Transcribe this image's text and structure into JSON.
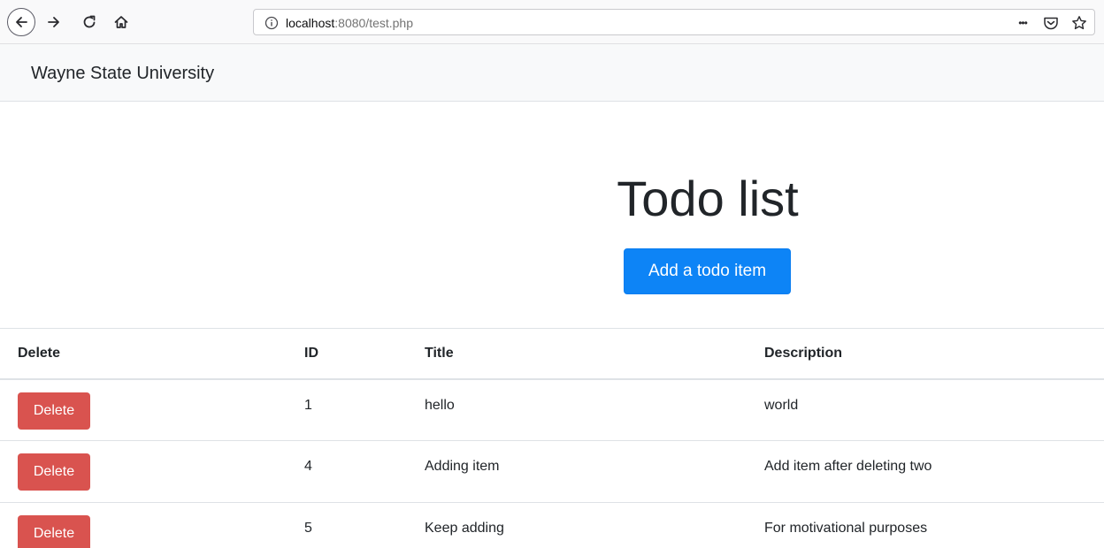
{
  "browser": {
    "url_host": "localhost",
    "url_rest": ":8080/test.php",
    "icons": [
      "back-arrow-icon",
      "forward-arrow-icon",
      "reload-icon",
      "home-icon",
      "info-icon",
      "more-icon",
      "pocket-icon",
      "bookmark-star-icon"
    ],
    "more_label": "•••"
  },
  "navbar": {
    "brand": "Wayne State University"
  },
  "main": {
    "title": "Todo list",
    "add_button": "Add a todo item",
    "accent_color": "#0d84f6",
    "delete_color": "#d9534f"
  },
  "table": {
    "headers": [
      "Delete",
      "ID",
      "Title",
      "Description"
    ],
    "rows": [
      {
        "delete_label": "Delete",
        "id": "1",
        "title": "hello",
        "description": "world"
      },
      {
        "delete_label": "Delete",
        "id": "4",
        "title": "Adding item",
        "description": "Add item after deleting two"
      },
      {
        "delete_label": "Delete",
        "id": "5",
        "title": "Keep adding",
        "description": "For motivational purposes"
      }
    ]
  }
}
